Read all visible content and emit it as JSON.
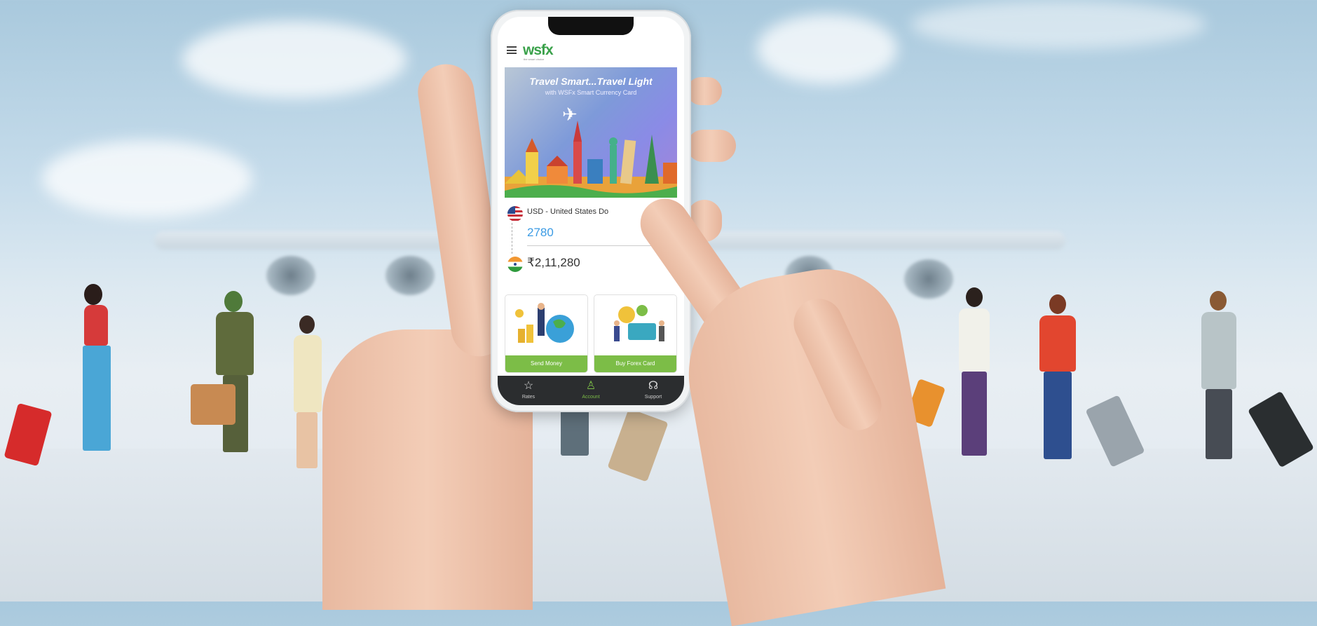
{
  "app": {
    "logo": "wsfx",
    "logo_sub": "the smart choice",
    "banner": {
      "title": "Travel Smart...Travel Light",
      "subtitle": "with WSFx Smart Currency Card"
    },
    "converter": {
      "from_currency": "USD - United States Do",
      "from_amount": "2780",
      "to_amount": "₹2,11,280"
    },
    "cards": [
      {
        "label": "Send Money"
      },
      {
        "label": "Buy Forex Card"
      }
    ],
    "nav": [
      {
        "label": "Rates",
        "icon": "star-icon"
      },
      {
        "label": "Account",
        "icon": "user-icon"
      },
      {
        "label": "Support",
        "icon": "headset-icon"
      }
    ]
  },
  "colors": {
    "brand_green": "#7cbd47",
    "amount_blue": "#3b9be4",
    "nav_bg": "#2b2d2f"
  }
}
